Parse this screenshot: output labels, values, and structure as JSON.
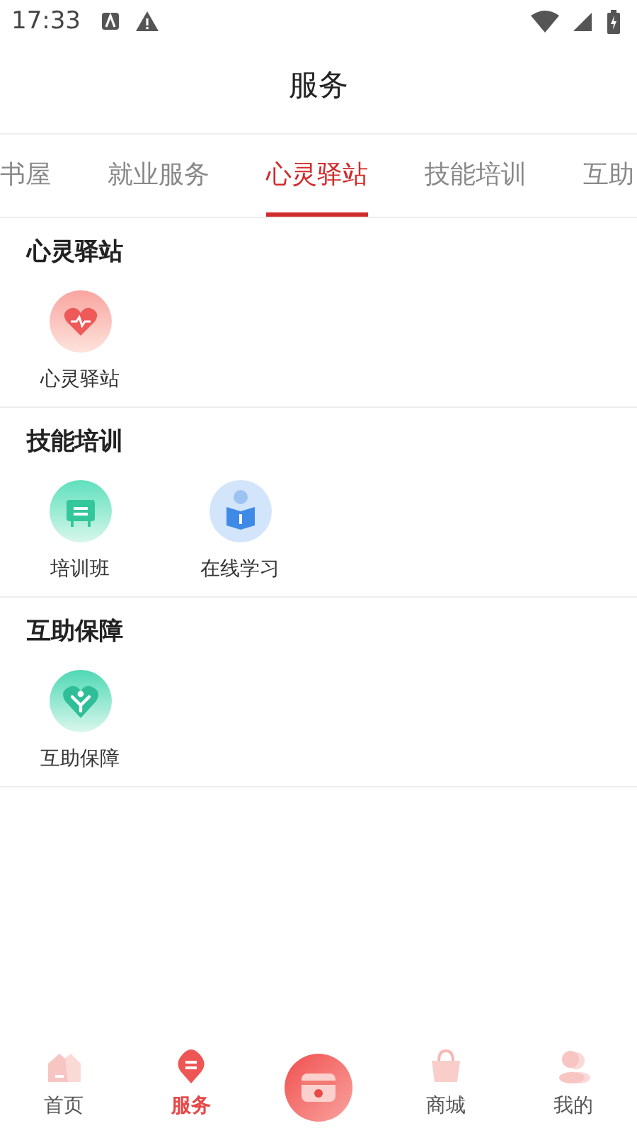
{
  "status_bar": {
    "time": "17:33"
  },
  "header": {
    "title": "服务"
  },
  "tabs": [
    {
      "label": "书屋",
      "selected": false
    },
    {
      "label": "就业服务",
      "selected": false
    },
    {
      "label": "心灵驿站",
      "selected": true
    },
    {
      "label": "技能培训",
      "selected": false
    },
    {
      "label": "互助",
      "selected": false
    }
  ],
  "sections": [
    {
      "title": "心灵驿站",
      "items": [
        {
          "label": "心灵驿站",
          "kind": "heart"
        }
      ]
    },
    {
      "title": "技能培训",
      "items": [
        {
          "label": "培训班",
          "kind": "board"
        },
        {
          "label": "在线学习",
          "kind": "reader"
        }
      ]
    },
    {
      "title": "互助保障",
      "items": [
        {
          "label": "互助保障",
          "kind": "care"
        }
      ]
    }
  ],
  "bottom_nav": [
    {
      "label": "首页",
      "kind": "home",
      "selected": false
    },
    {
      "label": "服务",
      "kind": "service",
      "selected": true
    },
    {
      "kind": "center",
      "selected": false
    },
    {
      "label": "商城",
      "kind": "shop",
      "selected": false
    },
    {
      "label": "我的",
      "kind": "user",
      "selected": false
    }
  ]
}
